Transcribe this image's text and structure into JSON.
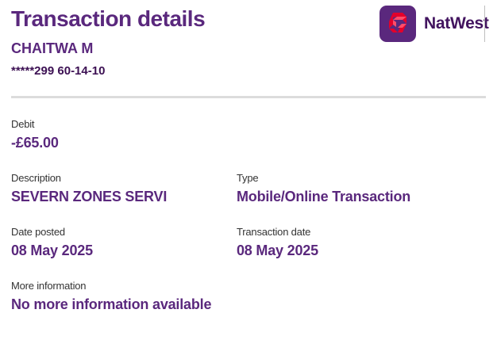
{
  "header": {
    "title": "Transaction details",
    "account_holder": "CHAITWA M",
    "account_details": "*****299 60-14-10"
  },
  "brand": {
    "name": "NatWest",
    "logo_icon": "natwest-cubes-icon",
    "color": "#5a287d",
    "mark_color": "#e4002b"
  },
  "details": {
    "debit": {
      "label": "Debit",
      "value": "-£65.00"
    },
    "description": {
      "label": "Description",
      "value": "SEVERN ZONES SERVI"
    },
    "type": {
      "label": "Type",
      "value": "Mobile/Online Transaction"
    },
    "date_posted": {
      "label": "Date posted",
      "value": "08 May 2025"
    },
    "transaction_date": {
      "label": "Transaction date",
      "value": "08 May 2025"
    },
    "more_information": {
      "label": "More information",
      "value": "No more information available"
    }
  }
}
